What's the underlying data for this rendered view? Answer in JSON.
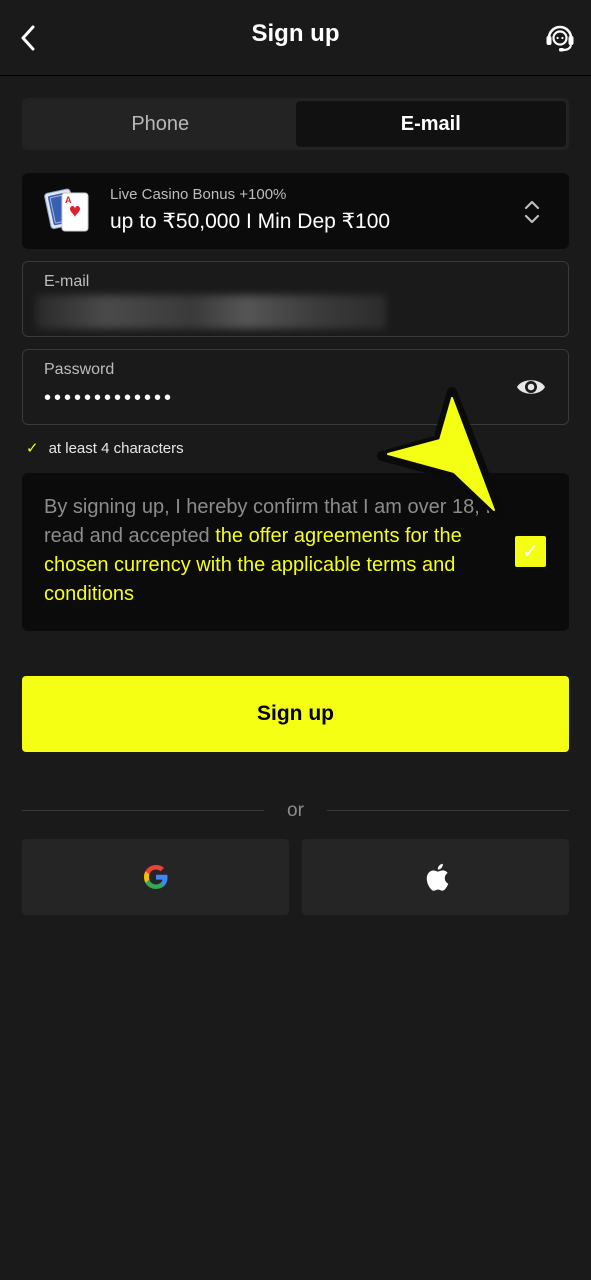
{
  "header": {
    "title": "Sign up",
    "back_icon": "chevron-left-icon",
    "support_icon": "headset-support-icon"
  },
  "tabs": [
    {
      "label": "Phone",
      "active": false
    },
    {
      "label": "E-mail",
      "active": true
    }
  ],
  "bonus": {
    "subtitle": "Live Casino Bonus +100%",
    "title": "up to ₹50,000 I Min Dep ₹100",
    "icon": "playing-cards-icon",
    "toggle_icon": "chevron-up-down-icon"
  },
  "email": {
    "label": "E-mail"
  },
  "password": {
    "label": "Password",
    "value": "•••••••••••••",
    "eye_icon": "eye-icon"
  },
  "hint": {
    "text": "at least 4 characters"
  },
  "agreement": {
    "plain": "By signing up, I hereby confirm that I am over 18, I read and accepted ",
    "link": "the offer agreements for the chosen currency with the applicable terms and conditions",
    "checked": true
  },
  "signup_button": "Sign up",
  "divider_text": "or",
  "social": [
    {
      "icon": "google-icon"
    },
    {
      "icon": "apple-icon"
    }
  ],
  "colors": {
    "accent": "#f5ff14",
    "background": "#1a1a1a",
    "panel": "#0b0b0b"
  }
}
